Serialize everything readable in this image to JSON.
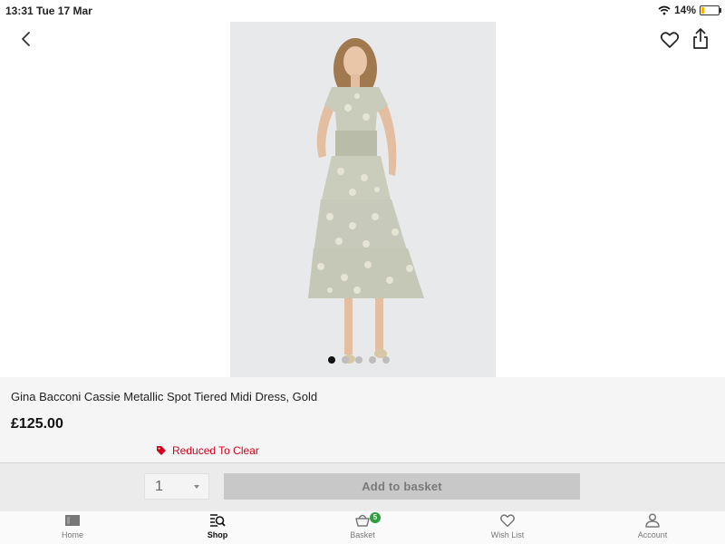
{
  "status_bar": {
    "time": "13:31",
    "date": "Tue 17 Mar",
    "battery": "14%",
    "battery_level": 0.14
  },
  "product": {
    "title": "Gina Bacconi Cassie Metallic Spot Tiered Midi Dress, Gold",
    "price": "£125.00",
    "promo": "Reduced To Clear",
    "image_count": 5,
    "active_image": 1
  },
  "purchase": {
    "quantity": "1",
    "add_label": "Add to basket"
  },
  "tabs": [
    {
      "label": "Home",
      "icon": "home-icon",
      "active": false
    },
    {
      "label": "Shop",
      "icon": "shop-search-icon",
      "active": true
    },
    {
      "label": "Basket",
      "icon": "basket-icon",
      "badge": "5",
      "active": false
    },
    {
      "label": "Wish List",
      "icon": "heart-icon",
      "active": false
    },
    {
      "label": "Account",
      "icon": "person-icon",
      "active": false
    }
  ],
  "colors": {
    "promo": "#d0021b",
    "badge": "#2e9e3e",
    "battery": "#f2b400"
  }
}
